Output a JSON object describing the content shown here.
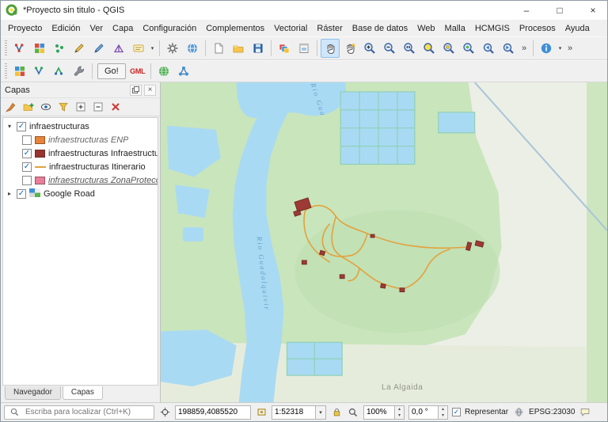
{
  "window": {
    "title": "*Proyecto sin titulo - QGIS"
  },
  "glyphs": {
    "minimize": "–",
    "maximize": "□",
    "close": "×",
    "dropdown": "▾",
    "overflow": "»",
    "check": "✓",
    "expander_open": "▾",
    "expander_closed": "▸",
    "spin_up": "▴",
    "spin_down": "▾"
  },
  "menubar": {
    "items": [
      "Proyecto",
      "Edición",
      "Ver",
      "Capa",
      "Configuración",
      "Complementos",
      "Vectorial",
      "Ráster",
      "Base de datos",
      "Web",
      "Malla",
      "HCMGIS",
      "Procesos",
      "Ayuda"
    ]
  },
  "toolbar": {
    "go_label": "Go!",
    "gml_label": "GML"
  },
  "icons": {
    "vertex-tool-icon": "blue V polyline with red nodes",
    "style-grid-icon": "4-color checker",
    "topology-points-icon": "green dots",
    "digitize-pencil-icon": "yellow pencil",
    "shape-digitize-icon": "blue pencil",
    "mesh-digitizing-icon": "purple triangle mesh",
    "annotation-icon": "note card",
    "processing-gear-icon": "gear",
    "web-globe-icon": "blue globe",
    "new-project-icon": "blank page",
    "open-project-icon": "yellow folder",
    "save-project-icon": "blue floppy",
    "style-manager-icon": "color chips",
    "layout-manager-icon": "page layout",
    "pan-map-icon": "hand (active)",
    "pan-to-selection-icon": "hand with star",
    "zoom-in-icon": "magnifier +",
    "zoom-out-icon": "magnifier −",
    "zoom-native-icon": "magnifier 1:1",
    "zoom-full-icon": "yellow magnifier",
    "zoom-to-selection-icon": "magnifier yellow box",
    "zoom-to-layer-icon": "magnifier layer",
    "zoom-last-icon": "magnifier ◂",
    "zoom-next-icon": "magnifier ▸",
    "identify-features-icon": "blue circle i",
    "wrench-tool-icon": "wrench",
    "quickmap-globe-icon": "green globe",
    "network-nodes-icon": "blue node graph",
    "layer-styling-icon": "brush",
    "add-group-icon": "folder plus",
    "map-themes-icon": "eye",
    "filter-legend-icon": "funnel",
    "expand-all-icon": "plus box",
    "collapse-all-icon": "minus box",
    "remove-layer-icon": "red cross",
    "locate-search-icon": "magnifier",
    "coordinate-icon": "crosshair",
    "extents-icon": "extent rectangle",
    "lock-scale-icon": "padlock",
    "magnifier-level-icon": "magnifier",
    "crs-globe-icon": "gray globe",
    "messages-icon": "speech bubble"
  },
  "layers_panel": {
    "title": "Capas",
    "tree": [
      {
        "label": "infraestructuras",
        "checked": true,
        "type": "group",
        "expanded": true
      },
      {
        "label": "infraestructuras ENP",
        "checked": false,
        "swatch_color": "#e8833a",
        "italic": true
      },
      {
        "label": "infraestructuras Infraestructu",
        "checked": true,
        "swatch_color": "#973430"
      },
      {
        "label": "infraestructuras Itinerario",
        "checked": true,
        "swatch_type": "line",
        "swatch_color": "#e2a23d"
      },
      {
        "label": "infraestructuras ZonaProtecc",
        "checked": false,
        "swatch_color": "#e87f9a",
        "italic": true,
        "underline": true
      },
      {
        "label": "Google Road",
        "checked": true,
        "type": "raster"
      }
    ],
    "tabs": [
      "Navegador",
      "Capas"
    ],
    "active_tab": "Capas"
  },
  "map": {
    "labels": {
      "river": "Rio Guadalquivir",
      "river_top": "Rio Gua",
      "place": "La Algaida"
    }
  },
  "statusbar": {
    "locate_placeholder": "Escriba para localizar (Ctrl+K)",
    "coordinate_value": "198859,4085520",
    "scale_value": "1:52318",
    "magnifier_value": "100%",
    "rotation_value": "0,0 °",
    "render_label": "Representar",
    "render_checked": true,
    "crs_label": "EPSG:23030"
  },
  "colors": {
    "tool_active_bg": "#cfe6fb",
    "water": "#a9daf3",
    "vegetation": "#c9e5bc",
    "trail": "#e2a23d",
    "infrastructure": "#9d3a35",
    "accent": "#0078d7"
  }
}
